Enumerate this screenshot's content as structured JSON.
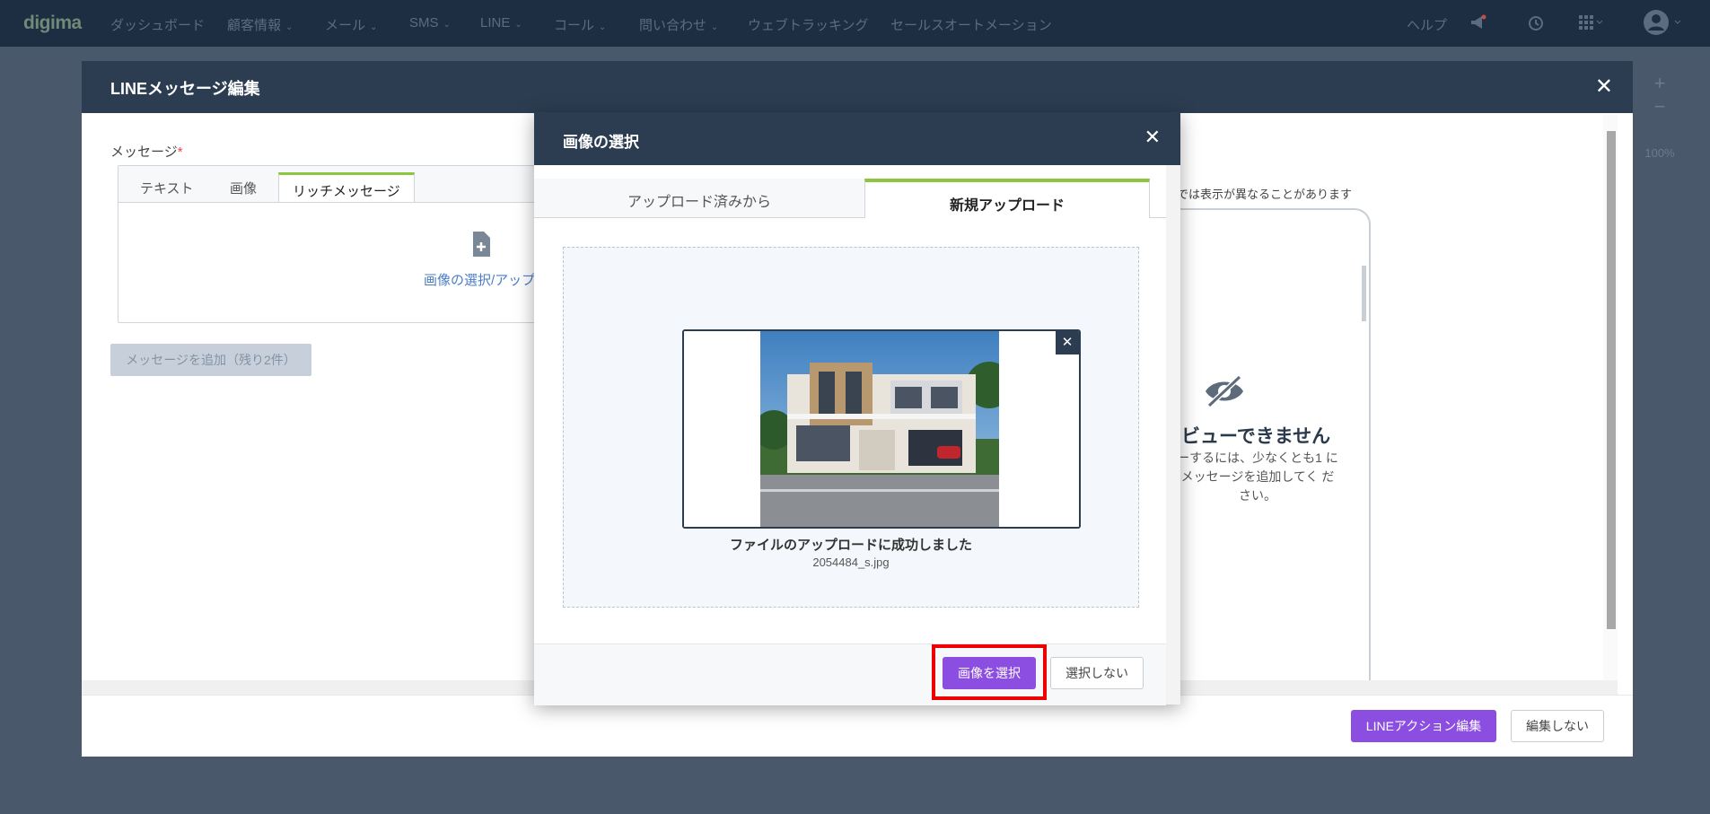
{
  "app": {
    "logo": "digima",
    "nav": [
      {
        "label": "ダッシュボード",
        "dropdown": false
      },
      {
        "label": "顧客情報",
        "dropdown": true
      },
      {
        "label": "メール",
        "dropdown": true
      },
      {
        "label": "SMS",
        "dropdown": true
      },
      {
        "label": "LINE",
        "dropdown": true
      },
      {
        "label": "コール",
        "dropdown": true
      },
      {
        "label": "問い合わせ",
        "dropdown": true
      },
      {
        "label": "ウェブトラッキング",
        "dropdown": false
      },
      {
        "label": "セールスオートメーション",
        "dropdown": false
      }
    ],
    "help_label": "ヘルプ",
    "zoom": "100%"
  },
  "modal": {
    "title": "LINEメッセージ編集",
    "message_label": "メッセージ",
    "required_mark": "*",
    "tabs": [
      "テキスト",
      "画像",
      "リッチメッセージ"
    ],
    "active_tab": "リッチメッセージ",
    "upload_link": "画像の選択/アップロード",
    "add_message_button": "メッセージを追加（残り2件）",
    "preview_note": "では表示が異なることがあります",
    "no_preview_title": "ビューできません",
    "no_preview_body": "ーするには、少なくとも1 にメッセージを追加してく ださい。",
    "footer_primary": "LINEアクション編集",
    "footer_secondary": "編集しない"
  },
  "dialog": {
    "title": "画像の選択",
    "tabs": [
      "アップロード済みから",
      "新規アップロード"
    ],
    "active_tab": "新規アップロード",
    "upload_success": "ファイルのアップロードに成功しました",
    "file_name": "2054484_s.jpg",
    "select_button": "画像を選択",
    "cancel_button": "選択しない"
  },
  "colors": {
    "nav_bg": "#1e2e42",
    "header_bg": "#2c3d52",
    "accent_green": "#8cc63f",
    "primary_purple": "#8c4ee0",
    "highlight_red": "#e00000"
  }
}
